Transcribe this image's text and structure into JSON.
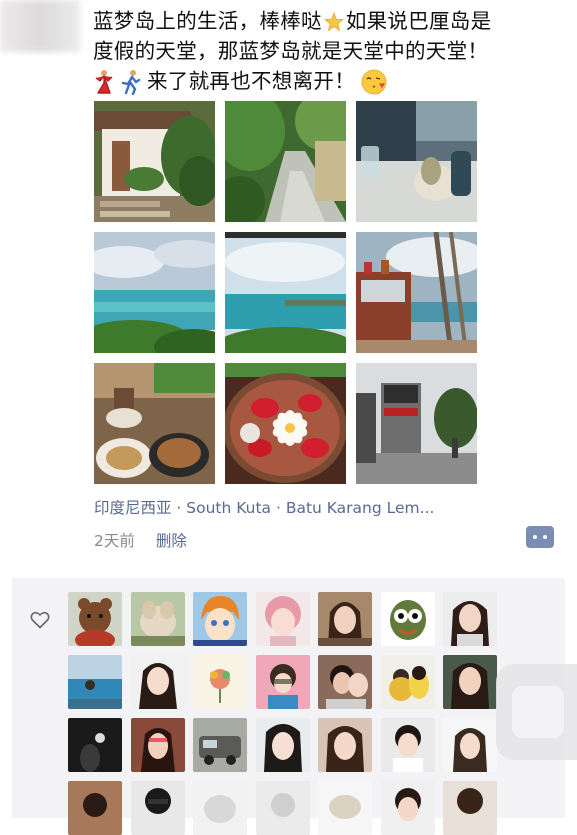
{
  "post": {
    "text_line1a": "蓝梦岛上的生活，棒棒哒",
    "text_line1b": "如果说巴厘岛是",
    "text_line2": "度假的天堂，那蓝梦岛就是天堂中的天堂！",
    "text_line3": "来了就再也不想离开！",
    "emoji": [
      "star",
      "dancer",
      "running-person",
      "kissing-face"
    ],
    "photos": [
      "villa-with-garden",
      "stone-path-garden",
      "cafe-table-drink",
      "cloudy-sea-bay",
      "sea-horizon-coast",
      "balcony-sea-view",
      "breakfast-plates",
      "frangipani-flower-bowl",
      "street-shop-sign"
    ],
    "location": "印度尼西亚 · South Kuta · Batu Karang Lem...",
    "time": "2天前",
    "delete_label": "删除",
    "comment_icon": "comment-dots-icon"
  },
  "likes": {
    "icon": "heart-outline-icon",
    "avatar_count": 28
  },
  "colors": {
    "link": "#5b6a92",
    "meta": "#8a8a8a",
    "panel": "#f3f3f5"
  }
}
